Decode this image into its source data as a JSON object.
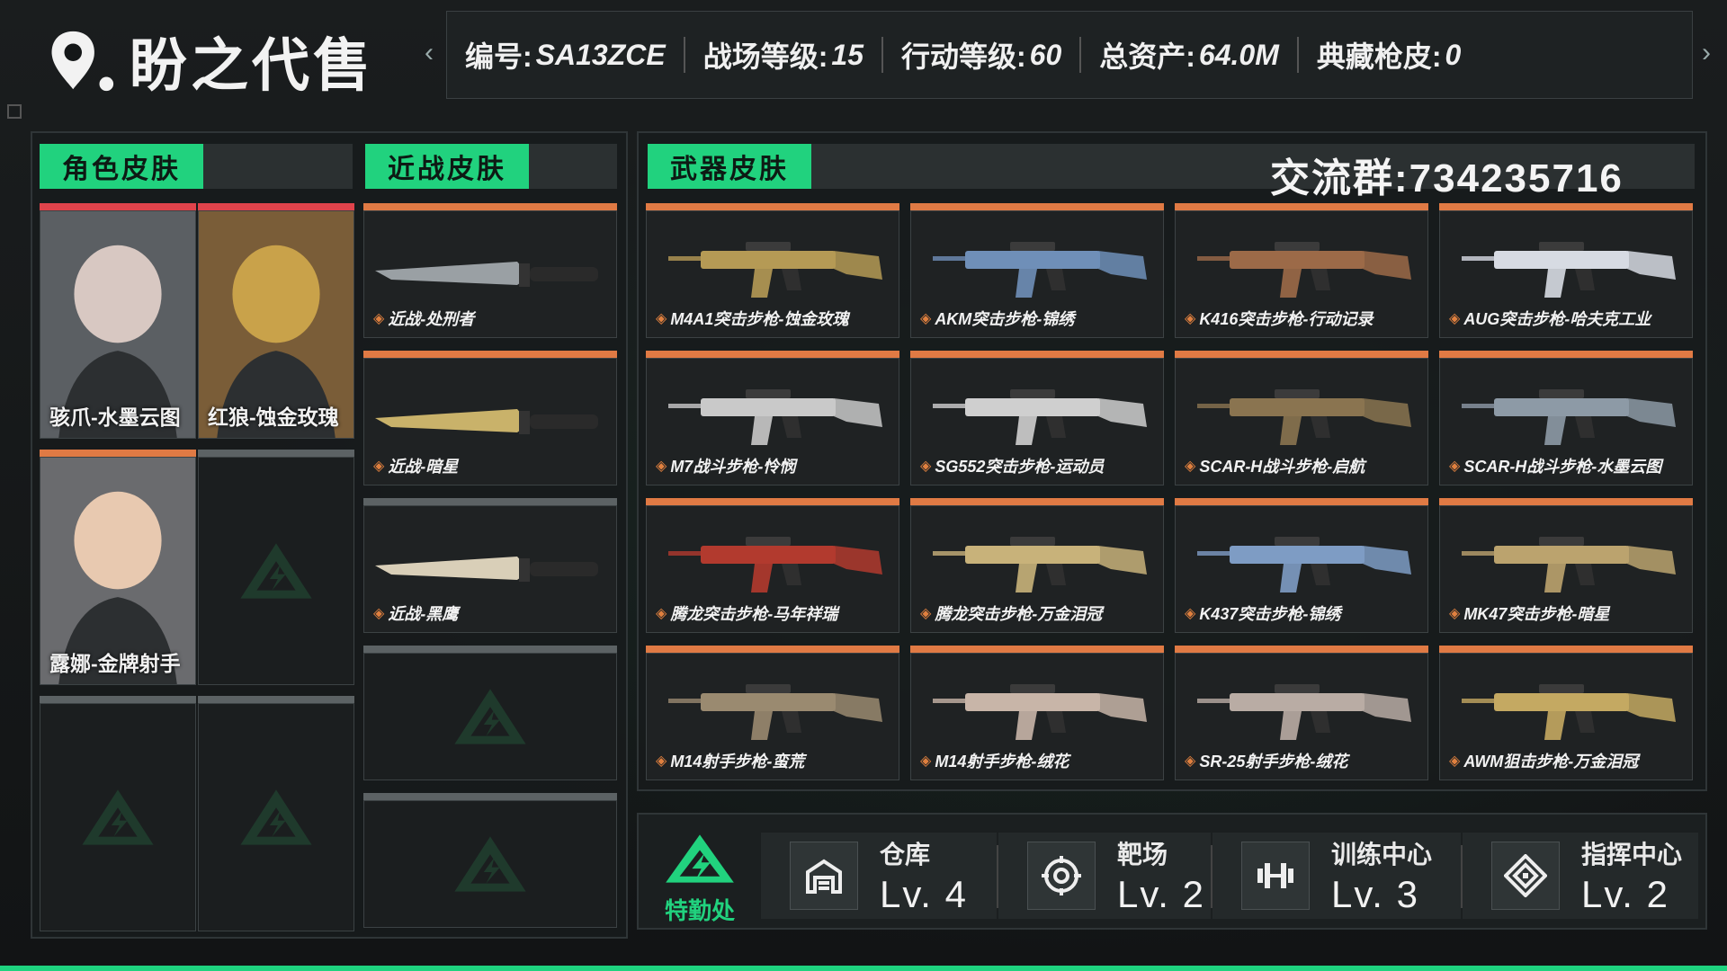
{
  "header": {
    "logo_text": "盼之代售",
    "info": [
      {
        "label": "编号:",
        "value": "SA13ZCE"
      },
      {
        "label": "战场等级:",
        "value": "15"
      },
      {
        "label": "行动等级:",
        "value": "60"
      },
      {
        "label": "总资产:",
        "value": "64.0M"
      },
      {
        "label": "典藏枪皮:",
        "value": "0"
      }
    ]
  },
  "sections": {
    "character": "角色皮肤",
    "melee": "近战皮肤",
    "weapon": "武器皮肤",
    "group": "交流群:734235716"
  },
  "character_skins": [
    {
      "name": "骇爪-水墨云图",
      "bar": "red"
    },
    {
      "name": "红狼-蚀金玫瑰",
      "bar": "red"
    },
    {
      "name": "露娜-金牌射手",
      "bar": "orange"
    },
    {
      "name": "",
      "bar": "gray"
    },
    {
      "name": "",
      "bar": "gray"
    },
    {
      "name": "",
      "bar": "gray"
    }
  ],
  "melee_skins": [
    {
      "name": "近战-处刑者",
      "bar": "orange"
    },
    {
      "name": "近战-暗星",
      "bar": "orange"
    },
    {
      "name": "近战-黑鹰",
      "bar": "gray"
    },
    {
      "name": "",
      "bar": "gray"
    },
    {
      "name": "",
      "bar": "gray"
    }
  ],
  "weapon_skins": [
    {
      "name": "M4A1突击步枪-蚀金玫瑰",
      "color": "#b59a55"
    },
    {
      "name": "AKM突击步枪-锦绣",
      "color": "#6f8fb8"
    },
    {
      "name": "K416突击步枪-行动记录",
      "color": "#9c6a48"
    },
    {
      "name": "AUG突击步枪-哈夫克工业",
      "color": "#d7dbe3"
    },
    {
      "name": "M7战斗步枪-怜悯",
      "color": "#c9c9c9"
    },
    {
      "name": "SG552突击步枪-运动员",
      "color": "#cfcfcf"
    },
    {
      "name": "SCAR-H战斗步枪-启航",
      "color": "#8a7450"
    },
    {
      "name": "SCAR-H战斗步枪-水墨云图",
      "color": "#8d9aa6"
    },
    {
      "name": "腾龙突击步枪-马年祥瑞",
      "color": "#b23a2e"
    },
    {
      "name": "腾龙突击步枪-万金泪冠",
      "color": "#c8b27a"
    },
    {
      "name": "K437突击步枪-锦绣",
      "color": "#7e9cc4"
    },
    {
      "name": "MK47突击步枪-暗星",
      "color": "#bba36e"
    },
    {
      "name": "M14射手步枪-蛮荒",
      "color": "#9a8a70"
    },
    {
      "name": "M14射手步枪-绒花",
      "color": "#c8b5a8"
    },
    {
      "name": "SR-25射手步枪-绒花",
      "color": "#b9aca4"
    },
    {
      "name": "AWM狙击步枪-万金泪冠",
      "color": "#c4a962"
    }
  ],
  "special_ops": {
    "title": "特勤处",
    "facilities": [
      {
        "name": "仓库",
        "level": "Lv. 4",
        "icon": "warehouse-icon"
      },
      {
        "name": "靶场",
        "level": "Lv. 2",
        "icon": "target-icon"
      },
      {
        "name": "训练中心",
        "level": "Lv. 3",
        "icon": "dumbbell-icon"
      },
      {
        "name": "指挥中心",
        "level": "Lv. 2",
        "icon": "command-icon"
      }
    ]
  },
  "colors": {
    "accent": "#21d27e",
    "rare": "#e0434b",
    "epic": "#e07a44",
    "common": "#5c6264"
  }
}
